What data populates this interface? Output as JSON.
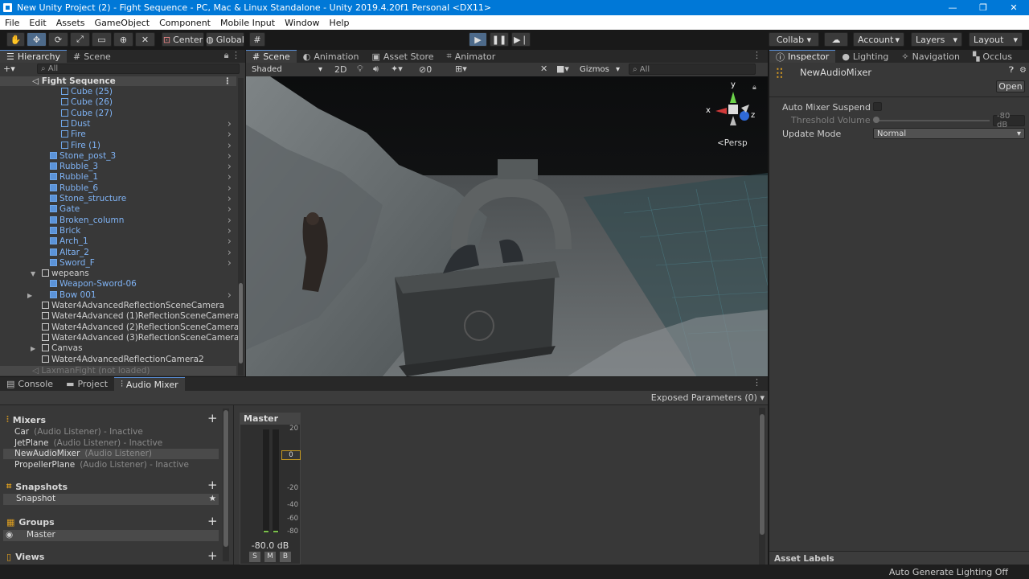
{
  "window": {
    "title": "New Unity Project (2) - Fight Sequence - PC, Mac & Linux Standalone - Unity 2019.4.20f1 Personal <DX11>",
    "controls": [
      "—",
      "❐",
      "✕"
    ]
  },
  "menu": [
    "File",
    "Edit",
    "Assets",
    "GameObject",
    "Component",
    "Mobile Input",
    "Window",
    "Help"
  ],
  "toolbar": {
    "center": "Center",
    "global": "Global",
    "collab": "Collab",
    "account": "Account",
    "layers": "Layers",
    "layout": "Layout"
  },
  "hierarchy": {
    "tab": "Hierarchy",
    "tab2": "Scene",
    "search_placeholder": "All",
    "add": "+▾",
    "scene": "Fight Sequence",
    "items": [
      {
        "label": "Cube (25)",
        "indent": 2,
        "color": "blue",
        "arrow": false
      },
      {
        "label": "Cube (26)",
        "indent": 2,
        "color": "blue",
        "arrow": false
      },
      {
        "label": "Cube (27)",
        "indent": 2,
        "color": "blue",
        "arrow": false
      },
      {
        "label": "Dust",
        "indent": 2,
        "color": "blue",
        "arrow": true
      },
      {
        "label": "Fire",
        "indent": 2,
        "color": "blue",
        "arrow": true
      },
      {
        "label": "Fire (1)",
        "indent": 2,
        "color": "blue",
        "arrow": true
      },
      {
        "label": "Stone_post_3",
        "indent": 1,
        "color": "blue",
        "arrow": true
      },
      {
        "label": "Rubble_3",
        "indent": 1,
        "color": "blue",
        "arrow": true
      },
      {
        "label": "Rubble_1",
        "indent": 1,
        "color": "blue",
        "arrow": true
      },
      {
        "label": "Rubble_6",
        "indent": 1,
        "color": "blue",
        "arrow": true
      },
      {
        "label": "Stone_structure",
        "indent": 1,
        "color": "blue",
        "arrow": true
      },
      {
        "label": "Gate",
        "indent": 1,
        "color": "blue",
        "arrow": true
      },
      {
        "label": "Broken_column",
        "indent": 1,
        "color": "blue",
        "arrow": true
      },
      {
        "label": "Brick",
        "indent": 1,
        "color": "blue",
        "arrow": true
      },
      {
        "label": "Arch_1",
        "indent": 1,
        "color": "blue",
        "arrow": true
      },
      {
        "label": "Altar_2",
        "indent": 1,
        "color": "blue",
        "arrow": true
      },
      {
        "label": "Sword_F",
        "indent": 1,
        "color": "blue",
        "arrow": true
      },
      {
        "label": "wepeans",
        "indent": 0,
        "color": "white",
        "arrow": false,
        "fold": "▼"
      },
      {
        "label": "Weapon-Sword-06",
        "indent": 1,
        "color": "blue",
        "arrow": false
      },
      {
        "label": "Bow 001",
        "indent": 1,
        "color": "blue",
        "arrow": true,
        "fold": "▶"
      },
      {
        "label": "Water4AdvancedReflectionSceneCamera",
        "indent": 0,
        "color": "white",
        "arrow": false
      },
      {
        "label": "Water4Advanced (1)ReflectionSceneCamera",
        "indent": 0,
        "color": "white",
        "arrow": false
      },
      {
        "label": "Water4Advanced (2)ReflectionSceneCamera",
        "indent": 0,
        "color": "white",
        "arrow": false
      },
      {
        "label": "Water4Advanced (3)ReflectionSceneCamera",
        "indent": 0,
        "color": "white",
        "arrow": false
      },
      {
        "label": "Canvas",
        "indent": 0,
        "color": "white",
        "arrow": false,
        "fold": "▶"
      },
      {
        "label": "Water4AdvancedReflectionCamera2",
        "indent": 0,
        "color": "white",
        "arrow": false
      }
    ],
    "unloaded": "LaxmanFight (not loaded)"
  },
  "scene": {
    "tabs": [
      "Scene",
      "Animation",
      "Asset Store",
      "Animator"
    ],
    "shading": "Shaded",
    "mode2d": "2D",
    "hidden_count": "0",
    "gizmos": "Gizmos",
    "search_placeholder": "All",
    "persp": "<Persp",
    "axis": {
      "y": "y",
      "x": "x",
      "z": "z"
    }
  },
  "inspector": {
    "tabs": [
      "Inspector",
      "Lighting",
      "Navigation",
      "Occlus"
    ],
    "object": "NewAudioMixer",
    "open": "Open",
    "auto_suspend_label": "Auto Mixer Suspend",
    "threshold_label": "Threshold Volume",
    "threshold_value": "-80 dB",
    "update_mode_label": "Update Mode",
    "update_mode_value": "Normal",
    "asset_labels": "Asset Labels"
  },
  "bottom": {
    "tabs": [
      "Console",
      "Project",
      "Audio Mixer"
    ],
    "exposed": "Exposed Parameters (0) ▾",
    "mixers_title": "Mixers",
    "mixers": [
      {
        "name": "Car",
        "info": "(Audio Listener) - Inactive"
      },
      {
        "name": "JetPlane",
        "info": "(Audio Listener) - Inactive"
      },
      {
        "name": "NewAudioMixer",
        "info": "(Audio Listener)"
      },
      {
        "name": "PropellerPlane",
        "info": "(Audio Listener) - Inactive"
      }
    ],
    "snapshots_title": "Snapshots",
    "snapshot": "Snapshot",
    "groups_title": "Groups",
    "group": "Master",
    "views_title": "Views",
    "strip": {
      "name": "Master",
      "db": "-80.0 dB",
      "scale": [
        "20",
        "0",
        "-20",
        "-40",
        "-60",
        "-80"
      ],
      "marker": "0",
      "s": "S",
      "m": "M",
      "b": "B"
    }
  },
  "status": {
    "text": "Auto Generate Lighting Off"
  }
}
